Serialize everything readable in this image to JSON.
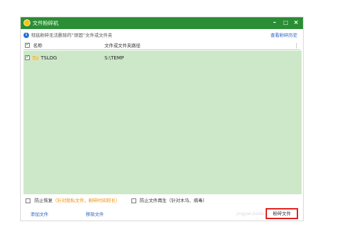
{
  "window": {
    "title": "文件粉碎机",
    "controls": {
      "minimize": "–",
      "maximize": "□",
      "close": "×"
    },
    "accent_color": "#2a8e34"
  },
  "infobar": {
    "icon": "info-icon",
    "text": "彻底粉碎无法删除的“顽固”文件或文件夹",
    "history_link": "查看粉碎历史"
  },
  "columns": {
    "name": "名称",
    "path": "文件或文件夹路径"
  },
  "files": [
    {
      "name": "TSLOG",
      "path": "S:\\TEMP",
      "checked": true,
      "icon": "folder-icon"
    }
  ],
  "options": {
    "prevent_recovery": {
      "label": "防止恢复",
      "note": "（针对隐私文件，粉碎时间较长）",
      "checked": false
    },
    "prevent_regen": {
      "label": "防止文件再生（针对木马、病毒）",
      "checked": false
    }
  },
  "footer": {
    "add_file": "添加文件",
    "remove_file": "移除文件",
    "watermark": "jingyan.baidu.com",
    "shred_button": "粉碎文件",
    "highlight_color": "#e0201f"
  }
}
